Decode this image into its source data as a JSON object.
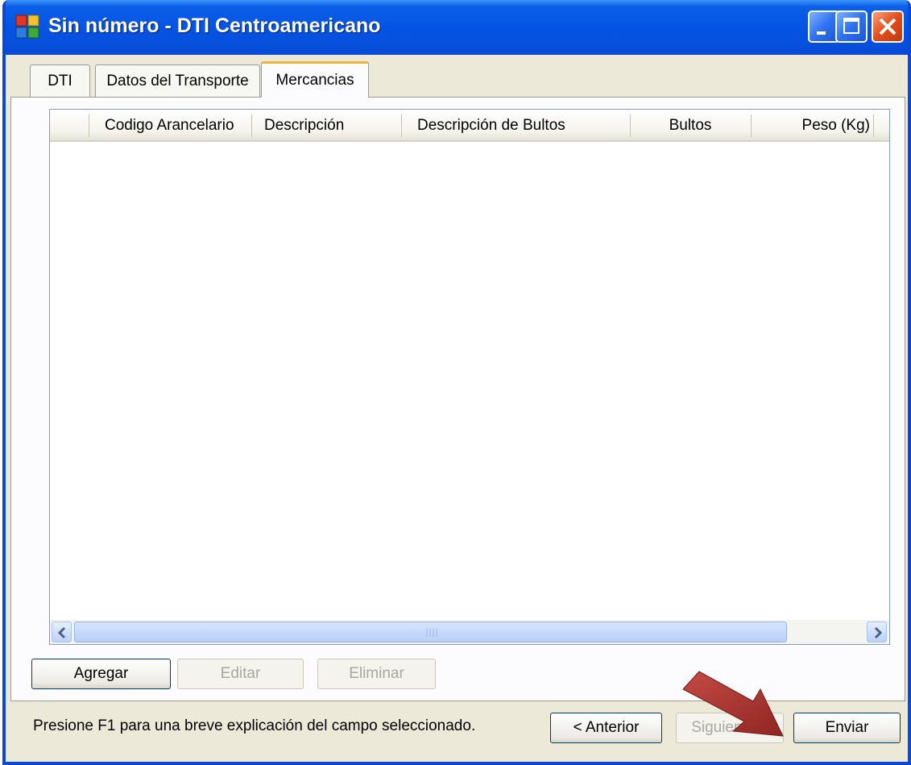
{
  "window": {
    "title": "Sin número - DTI Centroamericano"
  },
  "tabs": [
    {
      "label": "DTI"
    },
    {
      "label": "Datos del Transporte"
    },
    {
      "label": "Mercancias"
    }
  ],
  "table": {
    "columns": [
      "",
      "Codigo Arancelario",
      "Descripción",
      "Descripción de Bultos",
      "Bultos",
      "Peso (Kg)"
    ],
    "rows": []
  },
  "scrollbar": {
    "left_arrow": "<",
    "right_arrow": ">",
    "grip": "|||"
  },
  "actions": {
    "add": "Agregar",
    "edit": "Editar",
    "delete": "Eliminar"
  },
  "footer": {
    "hint": "Presione F1 para una breve explicación del campo seleccionado.",
    "previous": "< Anterior",
    "next": "Siguiente >",
    "send": "Enviar"
  },
  "colors": {
    "titlebar": "#0554e3",
    "window_bg": "#ece9d8",
    "active_tab_accent": "#f0b33a",
    "annotation_arrow": "#a8322f"
  },
  "icons": [
    "app-icon",
    "minimize-icon",
    "maximize-icon",
    "close-icon",
    "arrow-annotation-icon"
  ]
}
